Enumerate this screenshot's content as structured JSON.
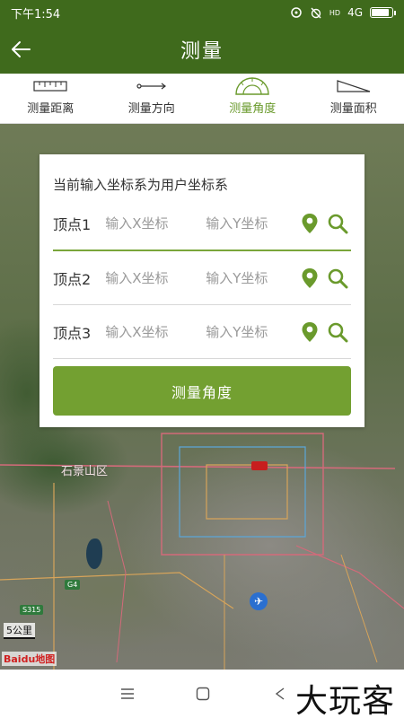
{
  "status_bar": {
    "time": "下午1:54",
    "network": "4G",
    "hd_badge": "HD",
    "battery_fraction": 0.9
  },
  "app_bar": {
    "title": "测量",
    "back_icon": "arrow-left-icon"
  },
  "tabs": [
    {
      "label": "测量距离",
      "icon": "ruler-icon",
      "active": false
    },
    {
      "label": "测量方向",
      "icon": "arrow-direction-icon",
      "active": false
    },
    {
      "label": "测量角度",
      "icon": "protractor-icon",
      "active": true
    },
    {
      "label": "测量面积",
      "icon": "triangle-area-icon",
      "active": false
    }
  ],
  "panel": {
    "note": "当前输入坐标系为用户坐标系",
    "vertices": [
      {
        "label": "顶点1",
        "x_placeholder": "输入X坐标",
        "y_placeholder": "输入Y坐标"
      },
      {
        "label": "顶点2",
        "x_placeholder": "输入X坐标",
        "y_placeholder": "输入Y坐标"
      },
      {
        "label": "顶点3",
        "x_placeholder": "输入X坐标",
        "y_placeholder": "输入Y坐标"
      }
    ],
    "submit_label": "测量角度"
  },
  "map": {
    "district_label": "石景山区",
    "road_badges": [
      "G4",
      "S315"
    ],
    "scale_label": "5公里",
    "logo_text": "Baidu地图"
  },
  "nav_bar": {
    "watermark": "大玩客"
  },
  "colors": {
    "primary_dark": "#3f6a1c",
    "accent": "#73a031",
    "icon_green": "#6a9a2c"
  }
}
